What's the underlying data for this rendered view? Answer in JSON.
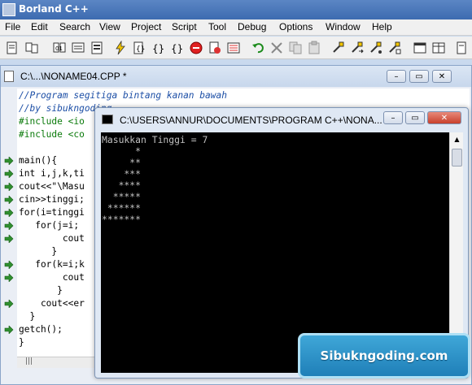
{
  "app": {
    "title": "Borland C++"
  },
  "menu": [
    "File",
    "Edit",
    "Search",
    "View",
    "Project",
    "Script",
    "Tool",
    "Debug",
    "Options",
    "Window",
    "Help"
  ],
  "editor": {
    "title": "C:\\...\\NONAME04.CPP *",
    "lines": [
      {
        "text": "//Program segitiga bintang kanan bawah",
        "kind": "comment"
      },
      {
        "text": "//by sibukngoding",
        "kind": "comment"
      },
      {
        "text": "#include <io",
        "kind": "pp"
      },
      {
        "text": "#include <co",
        "kind": "pp"
      },
      {
        "text": "",
        "kind": "code"
      },
      {
        "text": "main(){",
        "kind": "code"
      },
      {
        "text": "int i,j,k,ti",
        "kind": "code"
      },
      {
        "text": "cout<<\"\\Masu",
        "kind": "code"
      },
      {
        "text": "cin>>tinggi;",
        "kind": "code"
      },
      {
        "text": "for(i=tinggi",
        "kind": "code"
      },
      {
        "text": "   for(j=i;",
        "kind": "code"
      },
      {
        "text": "        cout",
        "kind": "code"
      },
      {
        "text": "      }",
        "kind": "code"
      },
      {
        "text": "   for(k=i;k",
        "kind": "code"
      },
      {
        "text": "        cout",
        "kind": "code"
      },
      {
        "text": "       }",
        "kind": "code"
      },
      {
        "text": "    cout<<er",
        "kind": "code"
      },
      {
        "text": "  }",
        "kind": "code"
      },
      {
        "text": "getch();",
        "kind": "code"
      },
      {
        "text": "}",
        "kind": "code"
      }
    ],
    "arrow_lines": [
      5,
      6,
      7,
      8,
      9,
      10,
      11,
      13,
      14,
      16,
      18
    ],
    "hscroll_glyph": "|||"
  },
  "console": {
    "title": "C:\\USERS\\ANNUR\\DOCUMENTS\\PROGRAM C++\\NONA...",
    "lines": [
      "Masukkan Tinggi = 7",
      "      *",
      "     **",
      "    ***",
      "   ****",
      "  *****",
      " ******",
      "*******"
    ],
    "scroll_up_glyph": "▲"
  },
  "window_buttons": {
    "minimize": "–",
    "maximize": "▭",
    "close": "✕"
  },
  "watermark": {
    "text": "Sibukngoding.com"
  },
  "colors": {
    "titlebar": "#3d6bb0",
    "console_bg": "#000000",
    "console_text": "#c0c0c0",
    "watermark": "#1f7fb8"
  }
}
